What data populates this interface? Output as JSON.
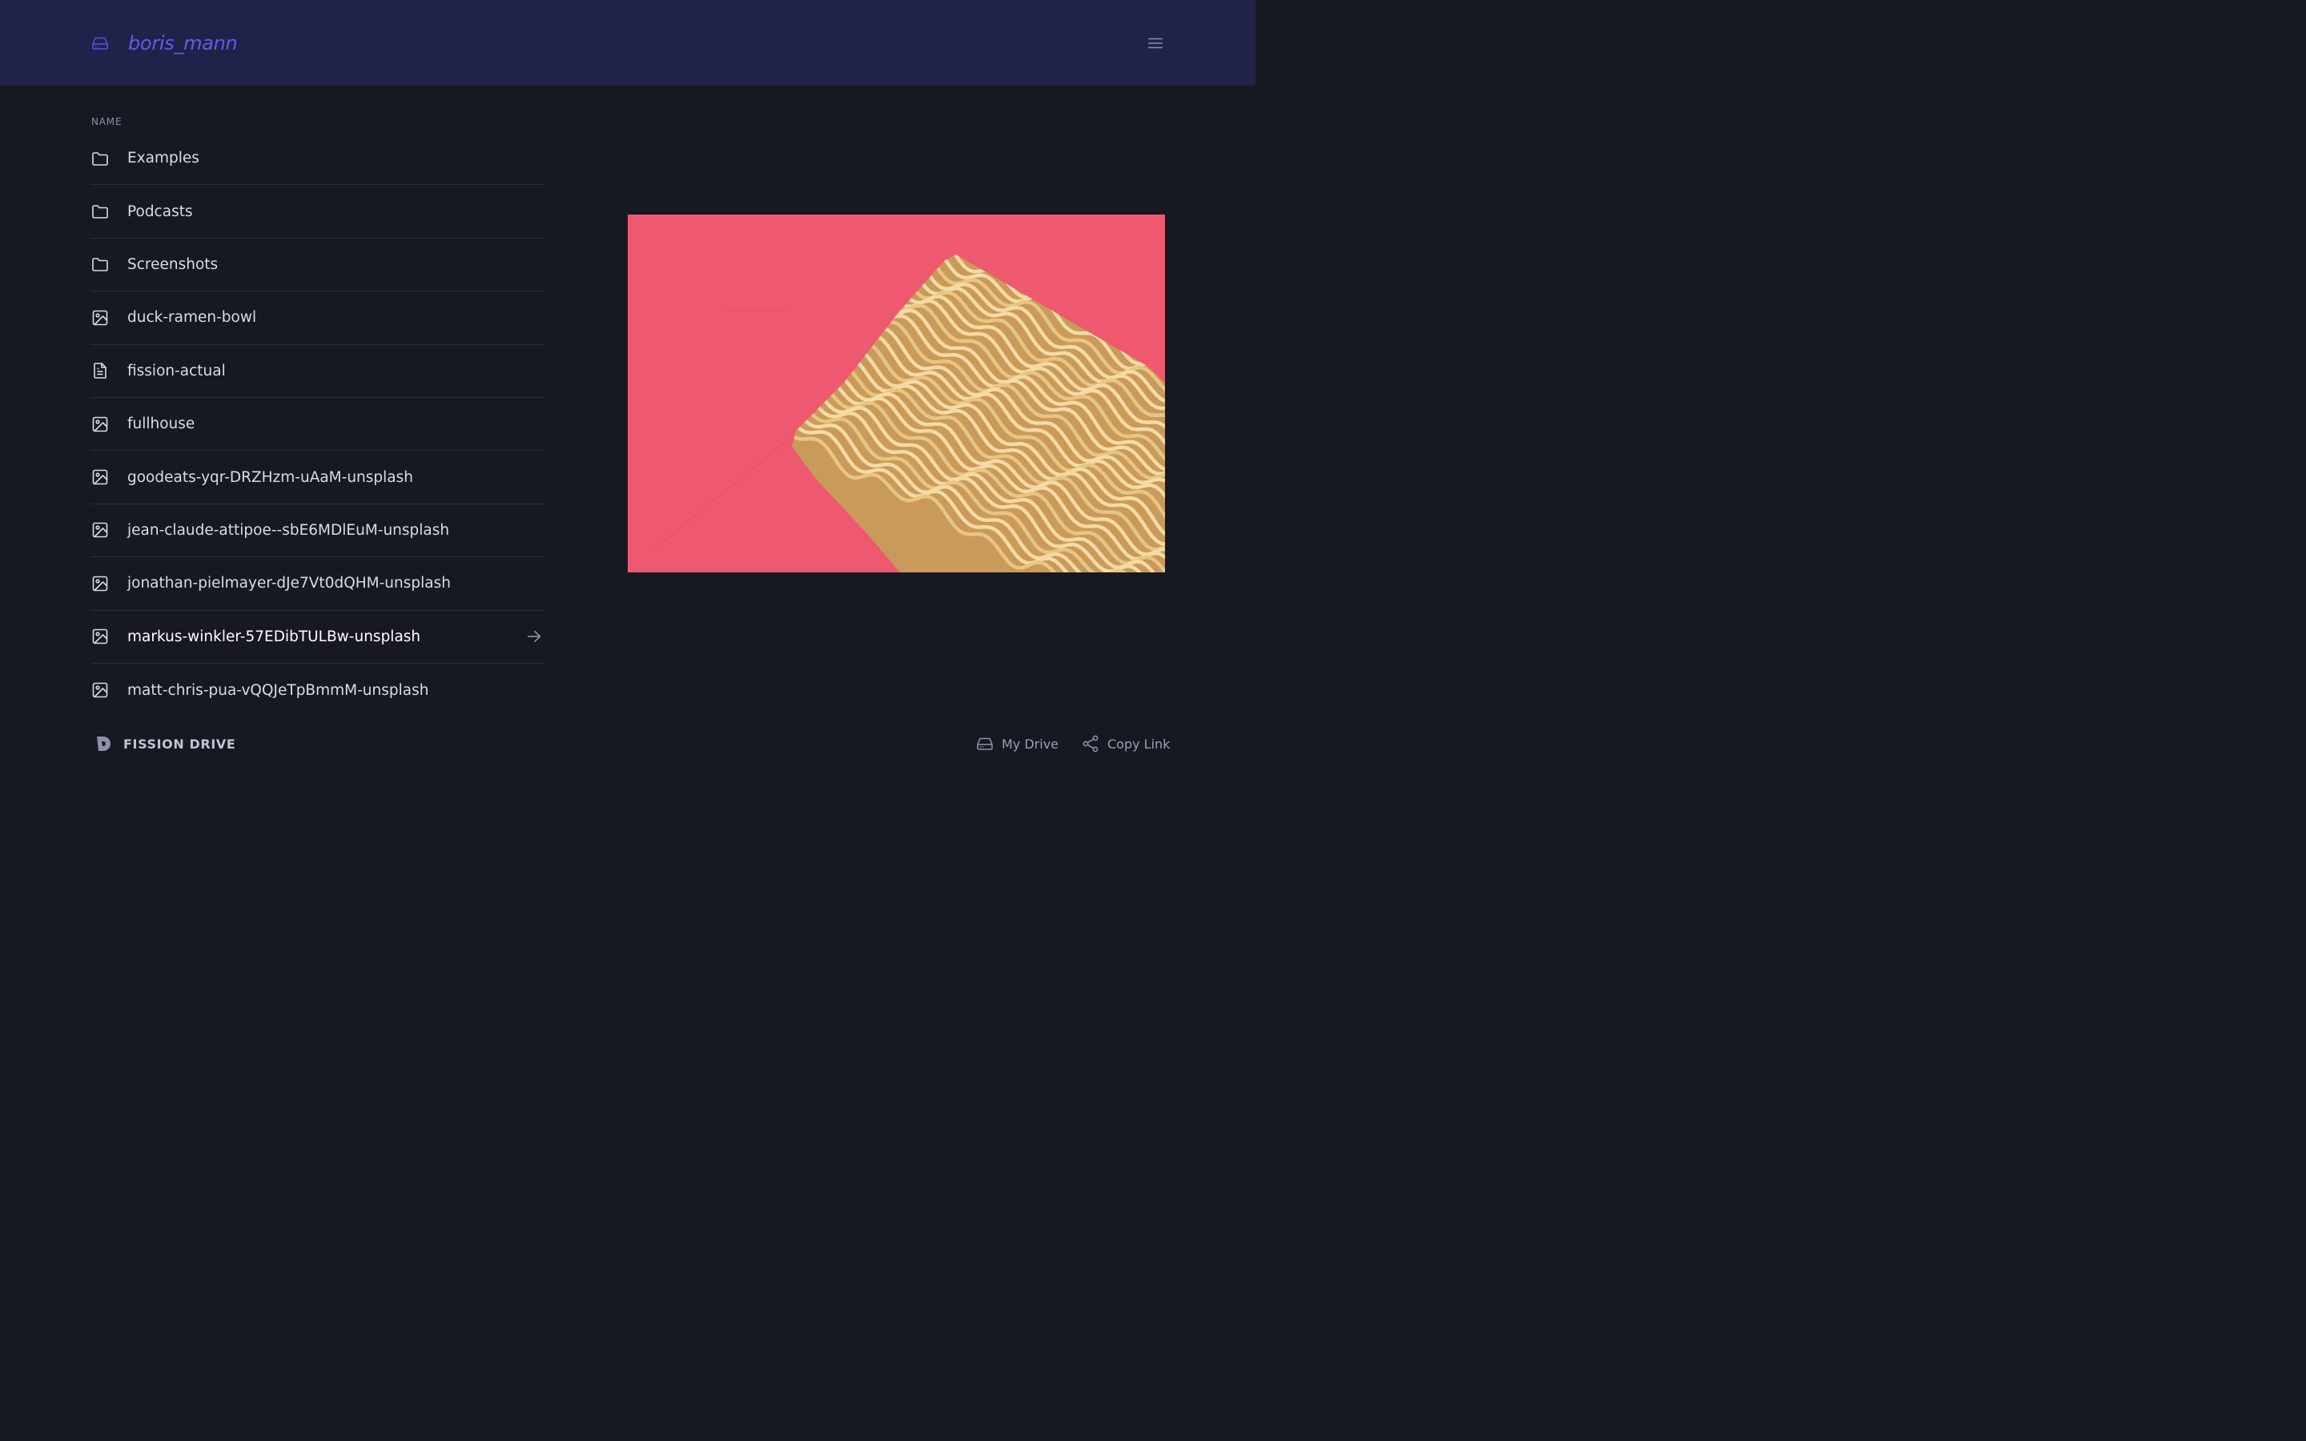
{
  "header": {
    "username": "boris_mann",
    "brand_icon": "drive-icon",
    "menu_icon": "hamburger-menu-icon"
  },
  "list": {
    "column_header": "NAME",
    "items": [
      {
        "name": "Examples",
        "icon": "folder-icon",
        "type": "folder"
      },
      {
        "name": "Podcasts",
        "icon": "folder-icon",
        "type": "folder"
      },
      {
        "name": "Screenshots",
        "icon": "folder-icon",
        "type": "folder"
      },
      {
        "name": "duck-ramen-bowl",
        "icon": "image-icon",
        "type": "image"
      },
      {
        "name": "fission-actual",
        "icon": "document-icon",
        "type": "document"
      },
      {
        "name": "fullhouse",
        "icon": "image-icon",
        "type": "image"
      },
      {
        "name": "goodeats-yqr-DRZHzm-uAaM-unsplash",
        "icon": "image-icon",
        "type": "image"
      },
      {
        "name": "jean-claude-attipoe--sbE6MDlEuM-unsplash",
        "icon": "image-icon",
        "type": "image"
      },
      {
        "name": "jonathan-pielmayer-dJe7Vt0dQHM-unsplash",
        "icon": "image-icon",
        "type": "image"
      },
      {
        "name": "markus-winkler-57EDibTULBw-unsplash",
        "icon": "image-icon",
        "type": "image",
        "selected": true
      },
      {
        "name": "matt-chris-pua-vQQJeTpBmmM-unsplash",
        "icon": "image-icon",
        "type": "image"
      }
    ]
  },
  "footer": {
    "brand": "FISSION DRIVE",
    "my_drive": "My Drive",
    "copy_link": "Copy Link"
  },
  "colors": {
    "header_bg": "#20224a",
    "page_bg": "#161822",
    "accent": "#6759e8",
    "preview_bg": "#f0576e",
    "noodle": "#f1d59a"
  }
}
